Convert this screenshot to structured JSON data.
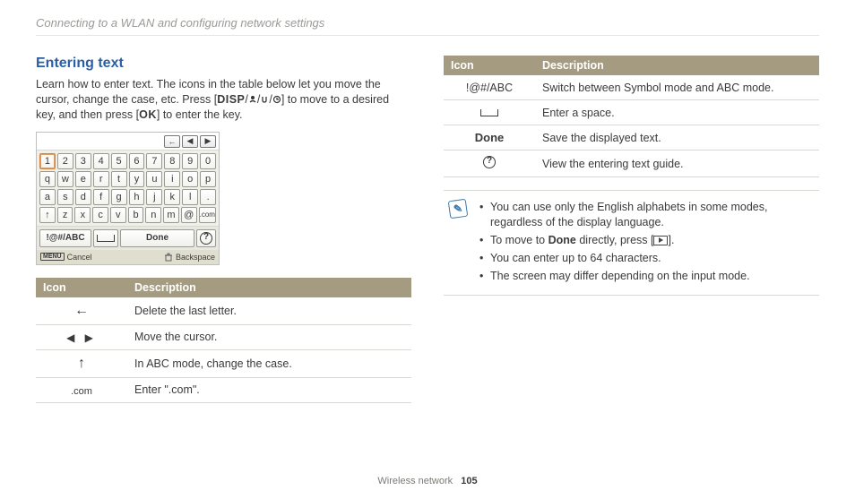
{
  "chapter": "Connecting to a WLAN and configuring network settings",
  "section_title": "Entering text",
  "intro_pre": "Learn how to enter text. The icons in the table below let you move the cursor, change the case, etc. Press [",
  "intro_disp": "DISP",
  "intro_mid": "] to move to a desired key, and then press [",
  "intro_ok": "OK",
  "intro_post": "] to enter the key.",
  "kbd": {
    "rows": [
      [
        "1",
        "2",
        "3",
        "4",
        "5",
        "6",
        "7",
        "8",
        "9",
        "0"
      ],
      [
        "q",
        "w",
        "e",
        "r",
        "t",
        "y",
        "u",
        "i",
        "o",
        "p"
      ],
      [
        "a",
        "s",
        "d",
        "f",
        "g",
        "h",
        "j",
        "k",
        "l",
        "."
      ],
      [
        "z",
        "x",
        "c",
        "v",
        "b",
        "n",
        "m",
        "@",
        ".com"
      ]
    ],
    "mode": "!@#/ABC",
    "done": "Done",
    "cancel_label": "Cancel",
    "menu_label": "MENU",
    "backspace_label": "Backspace"
  },
  "table_headers": {
    "icon": "Icon",
    "desc": "Description"
  },
  "left_table": [
    {
      "icon": "arrow-left-long",
      "desc": "Delete the last letter."
    },
    {
      "icon": "arrows-lr",
      "text": "◀   ▶",
      "desc": "Move the cursor."
    },
    {
      "icon": "arrow-up",
      "desc": "In ABC mode, change the case."
    },
    {
      "icon": "dotcom",
      "text": ".com",
      "desc": "Enter \".com\"."
    }
  ],
  "right_table": [
    {
      "icon": "modeabc",
      "text": "!@#/ABC",
      "desc": "Switch between Symbol mode and ABC mode."
    },
    {
      "icon": "spacebar",
      "desc": "Enter a space."
    },
    {
      "icon": "done",
      "text": "Done",
      "desc": "Save the displayed text."
    },
    {
      "icon": "qcircle",
      "desc": "View the entering text guide."
    }
  ],
  "notes": [
    "You can use only the English alphabets in some modes, regardless of the display language.",
    "To move to Done directly, press [▶].",
    "You can enter up to 64 characters.",
    "The screen may differ depending on the input mode."
  ],
  "note_done_word": "Done",
  "note_line2_pre": "To move to ",
  "note_line2_post": " directly, press [",
  "note_line2_end": "].",
  "footer": {
    "section": "Wireless network",
    "page": "105"
  }
}
